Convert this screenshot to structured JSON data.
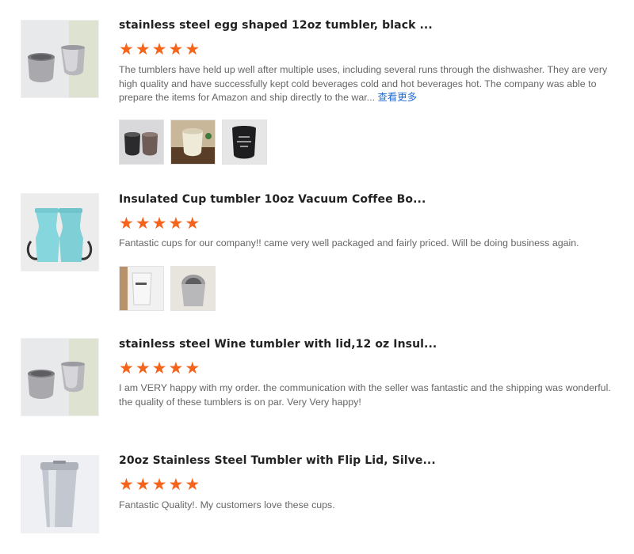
{
  "reviews": [
    {
      "title": "stainless steel egg shaped 12oz tumbler, black ...",
      "rating": 5,
      "text": "The tumblers have held up well after multiple uses, including several runs through the dishwasher.  They are very high quality and have successfully  kept cold beverages cold and hot beverages hot.  The company was able to prepare the items for Amazon and ship directly to the war...",
      "more_label": "查看更多",
      "product_image_icon": "egg-tumbler-pair-image",
      "photos": 3
    },
    {
      "title": "Insulated Cup tumbler 10oz Vacuum Coffee Bo...",
      "rating": 5,
      "text": "Fantastic cups for our company!! came very well packaged and fairly priced. Will be doing business again.",
      "product_image_icon": "teal-tumbler-pair-image",
      "photos": 2
    },
    {
      "title": "stainless steel Wine tumbler with lid,12 oz Insul...",
      "rating": 5,
      "text": "I am VERY happy with my order. the communication with the seller was fantastic and the shipping was wonderful. the quality of these tumblers is on par. Very Very happy!",
      "product_image_icon": "wine-tumbler-pair-image",
      "photos": 0
    },
    {
      "title": "20oz Stainless Steel Tumbler with Flip Lid, Silve...",
      "rating": 5,
      "text": "Fantastic Quality!. My customers love these cups.",
      "product_image_icon": "steel-tumbler-20oz-image",
      "photos": 0
    }
  ],
  "colors": {
    "star": "#f6641c",
    "link": "#1f6bd6",
    "teal": "#7ed3dc"
  }
}
